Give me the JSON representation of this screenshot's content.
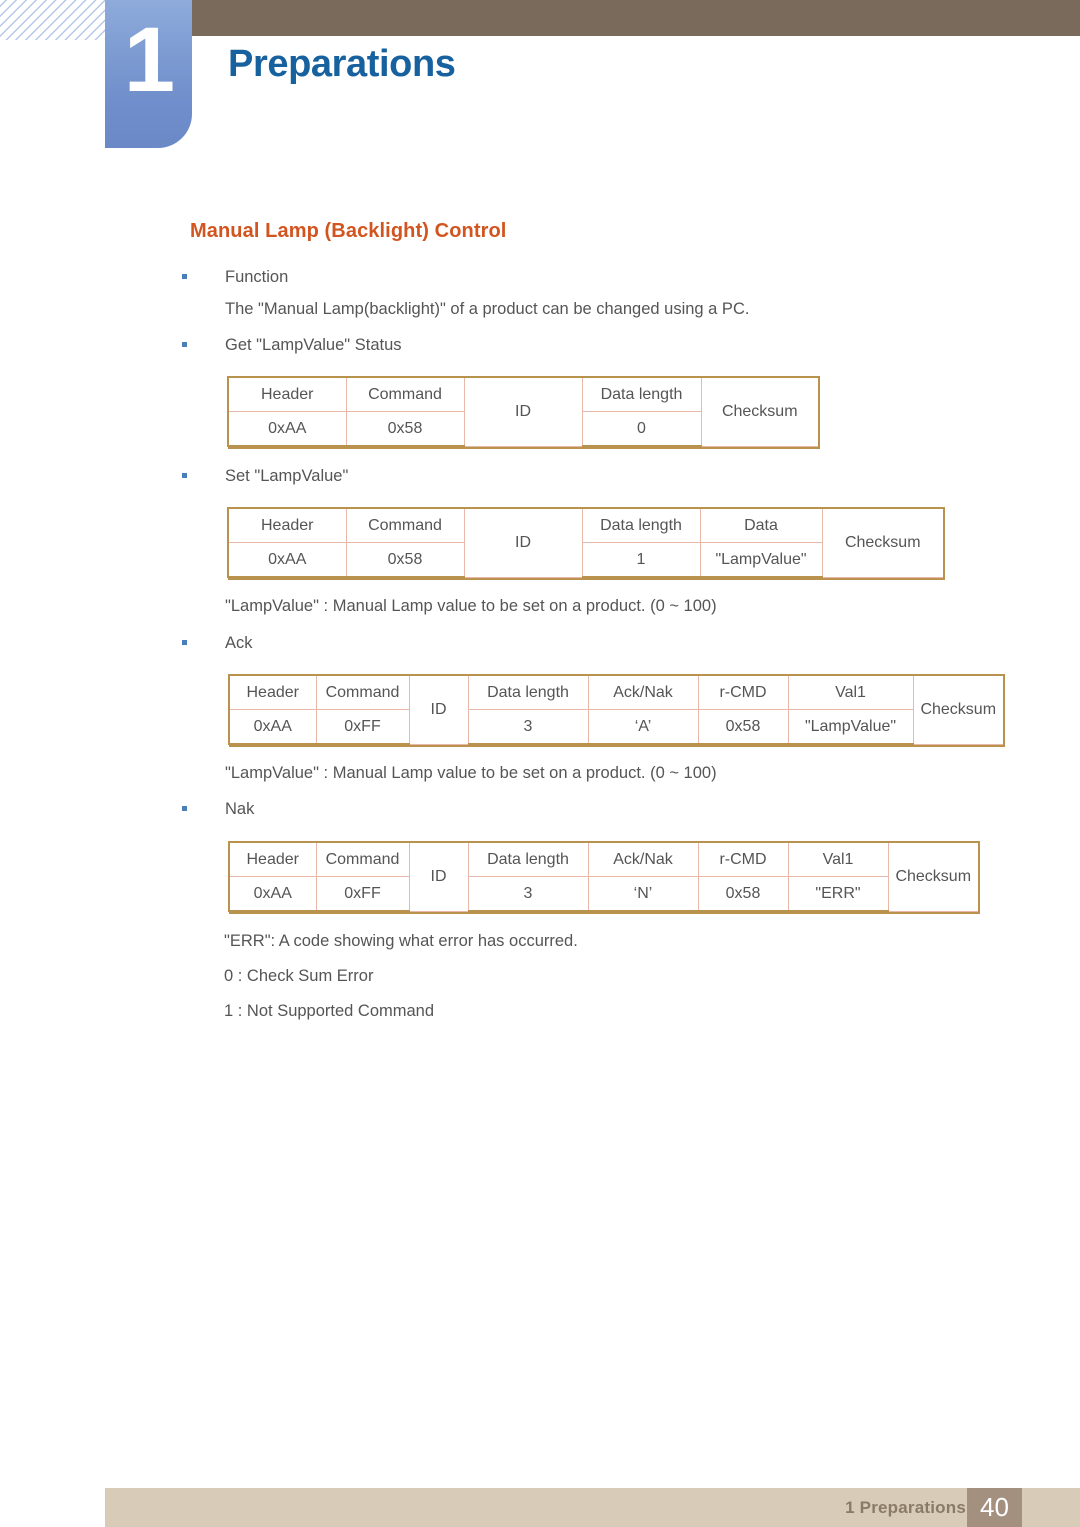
{
  "header": {
    "chapter_number": "1",
    "chapter_title": "Preparations",
    "accent_blue": "#17619e",
    "tab_blue": "#7e9cd2",
    "bar_brown": "#7a6a5c"
  },
  "section": {
    "heading": "Manual Lamp (Backlight)  Control",
    "heading_color": "#d2551f"
  },
  "bullets": {
    "function": "Function",
    "get_status": "Get \"LampValue\" Status",
    "set_value": "Set \"LampValue\"",
    "ack": "Ack",
    "nak": "Nak"
  },
  "lines": {
    "function_desc": "The \"Manual Lamp(backlight)\" of a product can be changed using a PC.",
    "lampvalue_note_1": "\"LampValue\" : Manual Lamp value to be set on a product. (0 ~ 100)",
    "lampvalue_note_2": "\"LampValue\" : Manual Lamp value to be set on a product. (0 ~ 100)",
    "err_desc": "\"ERR\": A code showing what error has occurred.",
    "err_code_0": "0 : Check Sum Error",
    "err_code_1": "1 : Not Supported Command"
  },
  "tables": {
    "get_status": {
      "headers": [
        "Header",
        "Command",
        "ID",
        "Data length",
        "Checksum"
      ],
      "values": [
        "0xAA",
        "0x58",
        "",
        "0",
        ""
      ],
      "merged": [
        false,
        false,
        true,
        false,
        true
      ]
    },
    "set_value": {
      "headers": [
        "Header",
        "Command",
        "ID",
        "Data length",
        "Data",
        "Checksum"
      ],
      "values": [
        "0xAA",
        "0x58",
        "",
        "1",
        "\"LampValue\"",
        ""
      ],
      "merged": [
        false,
        false,
        true,
        false,
        false,
        true
      ]
    },
    "ack": {
      "headers": [
        "Header",
        "Command",
        "ID",
        "Data length",
        "Ack/Nak",
        "r-CMD",
        "Val1",
        "Checksum"
      ],
      "values": [
        "0xAA",
        "0xFF",
        "",
        "3",
        "‘A’",
        "0x58",
        "\"LampValue\"",
        ""
      ],
      "merged": [
        false,
        false,
        true,
        false,
        false,
        false,
        false,
        true
      ]
    },
    "nak": {
      "headers": [
        "Header",
        "Command",
        "ID",
        "Data length",
        "Ack/Nak",
        "r-CMD",
        "Val1",
        "Checksum"
      ],
      "values": [
        "0xAA",
        "0xFF",
        "",
        "3",
        "‘N’",
        "0x58",
        "\"ERR\"",
        ""
      ],
      "merged": [
        false,
        false,
        true,
        false,
        false,
        false,
        false,
        true
      ]
    }
  },
  "footer": {
    "label": "1 Preparations",
    "page_number": "40",
    "band_color": "#d8cbb8",
    "page_box_color": "#a3907f"
  }
}
